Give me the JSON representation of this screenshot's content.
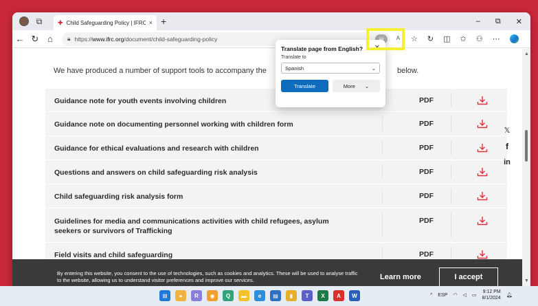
{
  "browser": {
    "tab_title": "Child Safeguarding Policy | IFRC",
    "tab_close": "×",
    "new_tab": "+",
    "url_prefix": "https://",
    "url_domain": "www.ifrc.org",
    "url_path": "/document/child-safeguarding-policy",
    "translate_badge": "a͜a",
    "window_controls": [
      "–",
      "⧉",
      "✕"
    ]
  },
  "translate_popup": {
    "title": "Translate page from English?",
    "label": "Translate to",
    "selected_language": "Spanish",
    "translate_label": "Translate",
    "more_label": "More"
  },
  "page": {
    "intro": "We have produced a number of support tools to accompany the",
    "intro_end": "below.",
    "documents": [
      {
        "title": "Guidance note for youth events involving children",
        "format": "PDF"
      },
      {
        "title": "Guidance note on documenting personnel working with children form",
        "format": "PDF"
      },
      {
        "title": "Guidance for ethical evaluations and research with children",
        "format": "PDF"
      },
      {
        "title": "Questions and answers on child safeguarding risk analysis",
        "format": "PDF"
      },
      {
        "title": "Child safeguarding risk analysis form",
        "format": "PDF"
      },
      {
        "title": "Guidelines for media and communications activities with child refugees, asylum seekers or survivors of Trafficking",
        "format": "PDF"
      },
      {
        "title": "Field visits and child safeguarding",
        "format": "PDF"
      }
    ],
    "social": [
      "𝕏",
      "f",
      "in"
    ]
  },
  "cookie_banner": {
    "text": "By entering this website, you consent to the use of technologies, such as cookies and analytics. These will be used to analyse traffic to the website, allowing us to understand visitor preferences and improve our services.",
    "learn_more": "Learn more",
    "accept": "I accept"
  },
  "taskbar": {
    "language": "ESP",
    "time": "9:12 PM",
    "date": "8/1/2024"
  },
  "colors": {
    "accent_red": "#d21d2a",
    "translate_blue": "#0f6cbd",
    "highlight_yellow": "#f5f031",
    "download_red": "#e0323c"
  }
}
